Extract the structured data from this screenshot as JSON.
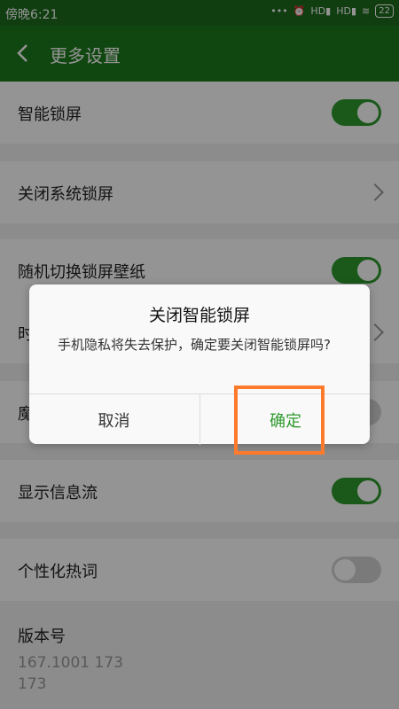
{
  "status_bar": {
    "time": "傍晚6:21",
    "signal1": "HD",
    "signal2": "HD",
    "battery": "22"
  },
  "app_bar": {
    "title": "更多设置"
  },
  "settings": [
    {
      "label": "智能锁屏",
      "control": "toggle-on"
    },
    {
      "label": "关闭系统锁屏",
      "control": "chevron"
    },
    {
      "label": "随机切换锁屏壁纸",
      "control": "toggle-on"
    },
    {
      "label": "时",
      "control": "chevron"
    },
    {
      "label": "魔",
      "control": "toggle-off"
    },
    {
      "label": "显示信息流",
      "control": "toggle-on"
    },
    {
      "label": "个性化热词",
      "control": "toggle-off"
    }
  ],
  "version": {
    "label": "版本号",
    "line1": "167.1001 173",
    "line2": "173"
  },
  "dialog": {
    "title": "关闭智能锁屏",
    "message": "手机隐私将失去保护，确定要关闭智能锁屏吗?",
    "cancel": "取消",
    "ok": "确定"
  },
  "colors": {
    "status_bar": "#1d6b1d",
    "app_bar": "#1d7a1d",
    "toggle_on": "#2e9a2e",
    "highlight": "#ff7a2b"
  }
}
